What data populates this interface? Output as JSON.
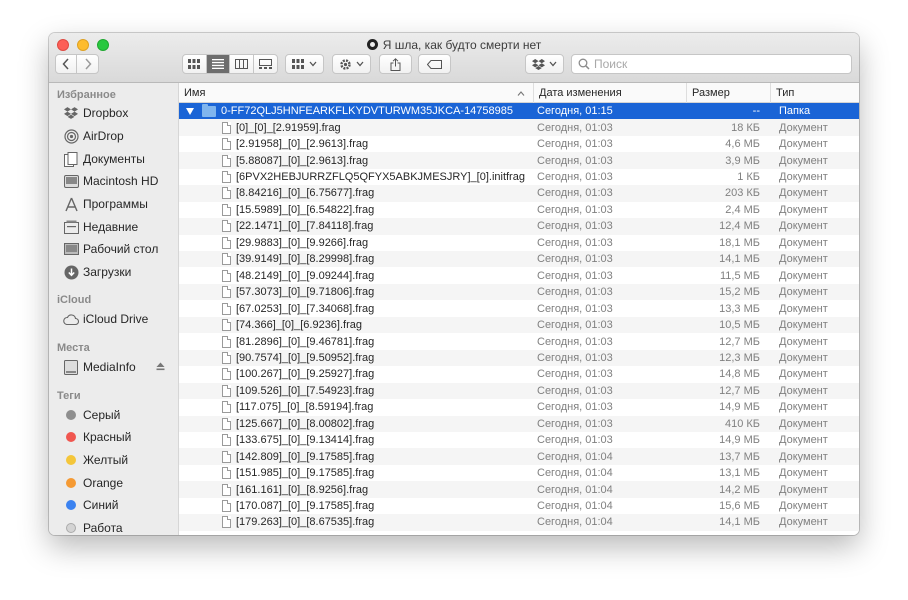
{
  "window": {
    "title": "Я шла, как будто смерти нет"
  },
  "toolbar": {
    "search_placeholder": "Поиск"
  },
  "colors": {
    "accent": "#1a64d6",
    "tag_gray": "#8e8e8e",
    "tag_red": "#f0564f",
    "tag_yellow": "#f4c63a",
    "tag_orange": "#f59a33",
    "tag_blue": "#3b82f0",
    "tag_work": "#d4d4d4"
  },
  "sidebar": {
    "favorites_label": "Избранное",
    "icloud_label": "iCloud",
    "places_label": "Места",
    "tags_label": "Теги",
    "favorites": [
      {
        "label": "Dropbox",
        "icon": "dropbox-icon"
      },
      {
        "label": "AirDrop",
        "icon": "airdrop-icon"
      },
      {
        "label": "Документы",
        "icon": "documents-icon"
      },
      {
        "label": "Macintosh HD",
        "icon": "harddrive-icon"
      },
      {
        "label": "Программы",
        "icon": "applications-icon"
      },
      {
        "label": "Недавние",
        "icon": "recents-icon"
      },
      {
        "label": "Рабочий стол",
        "icon": "desktop-icon"
      },
      {
        "label": "Загрузки",
        "icon": "downloads-icon"
      }
    ],
    "icloud": [
      {
        "label": "iCloud Drive",
        "icon": "cloud-icon"
      }
    ],
    "places": [
      {
        "label": "MediaInfo",
        "icon": "disk-icon"
      }
    ],
    "tags": [
      {
        "label": "Серый"
      },
      {
        "label": "Красный"
      },
      {
        "label": "Желтый"
      },
      {
        "label": "Orange"
      },
      {
        "label": "Синий"
      },
      {
        "label": "Работа"
      }
    ]
  },
  "columns": {
    "name": "Имя",
    "date": "Дата изменения",
    "size": "Размер",
    "kind": "Тип"
  },
  "folder": {
    "name": "0-FF72QLJ5HNFEARKFLKYDVTURWM35JKCA-14758985",
    "date": "Сегодня, 01:15",
    "size": "--",
    "kind": "Папка"
  },
  "files": [
    {
      "name": "[0]_[0]_[2.91959].frag",
      "date": "Сегодня, 01:03",
      "size": "18 КБ",
      "kind": "Документ"
    },
    {
      "name": "[2.91958]_[0]_[2.9613].frag",
      "date": "Сегодня, 01:03",
      "size": "4,6 МБ",
      "kind": "Документ"
    },
    {
      "name": "[5.88087]_[0]_[2.9613].frag",
      "date": "Сегодня, 01:03",
      "size": "3,9 МБ",
      "kind": "Документ"
    },
    {
      "name": "[6PVX2HEBJURRZFLQ5QFYX5ABKJMESJRY]_[0].initfrag",
      "date": "Сегодня, 01:03",
      "size": "1 КБ",
      "kind": "Документ"
    },
    {
      "name": "[8.84216]_[0]_[6.75677].frag",
      "date": "Сегодня, 01:03",
      "size": "203 КБ",
      "kind": "Документ"
    },
    {
      "name": "[15.5989]_[0]_[6.54822].frag",
      "date": "Сегодня, 01:03",
      "size": "2,4 МБ",
      "kind": "Документ"
    },
    {
      "name": "[22.1471]_[0]_[7.84118].frag",
      "date": "Сегодня, 01:03",
      "size": "12,4 МБ",
      "kind": "Документ"
    },
    {
      "name": "[29.9883]_[0]_[9.9266].frag",
      "date": "Сегодня, 01:03",
      "size": "18,1 МБ",
      "kind": "Документ"
    },
    {
      "name": "[39.9149]_[0]_[8.29998].frag",
      "date": "Сегодня, 01:03",
      "size": "14,1 МБ",
      "kind": "Документ"
    },
    {
      "name": "[48.2149]_[0]_[9.09244].frag",
      "date": "Сегодня, 01:03",
      "size": "11,5 МБ",
      "kind": "Документ"
    },
    {
      "name": "[57.3073]_[0]_[9.71806].frag",
      "date": "Сегодня, 01:03",
      "size": "15,2 МБ",
      "kind": "Документ"
    },
    {
      "name": "[67.0253]_[0]_[7.34068].frag",
      "date": "Сегодня, 01:03",
      "size": "13,3 МБ",
      "kind": "Документ"
    },
    {
      "name": "[74.366]_[0]_[6.9236].frag",
      "date": "Сегодня, 01:03",
      "size": "10,5 МБ",
      "kind": "Документ"
    },
    {
      "name": "[81.2896]_[0]_[9.46781].frag",
      "date": "Сегодня, 01:03",
      "size": "12,7 МБ",
      "kind": "Документ"
    },
    {
      "name": "[90.7574]_[0]_[9.50952].frag",
      "date": "Сегодня, 01:03",
      "size": "12,3 МБ",
      "kind": "Документ"
    },
    {
      "name": "[100.267]_[0]_[9.25927].frag",
      "date": "Сегодня, 01:03",
      "size": "14,8 МБ",
      "kind": "Документ"
    },
    {
      "name": "[109.526]_[0]_[7.54923].frag",
      "date": "Сегодня, 01:03",
      "size": "12,7 МБ",
      "kind": "Документ"
    },
    {
      "name": "[117.075]_[0]_[8.59194].frag",
      "date": "Сегодня, 01:03",
      "size": "14,9 МБ",
      "kind": "Документ"
    },
    {
      "name": "[125.667]_[0]_[8.00802].frag",
      "date": "Сегодня, 01:03",
      "size": "410 КБ",
      "kind": "Документ"
    },
    {
      "name": "[133.675]_[0]_[9.13414].frag",
      "date": "Сегодня, 01:03",
      "size": "14,9 МБ",
      "kind": "Документ"
    },
    {
      "name": "[142.809]_[0]_[9.17585].frag",
      "date": "Сегодня, 01:04",
      "size": "13,7 МБ",
      "kind": "Документ"
    },
    {
      "name": "[151.985]_[0]_[9.17585].frag",
      "date": "Сегодня, 01:04",
      "size": "13,1 МБ",
      "kind": "Документ"
    },
    {
      "name": "[161.161]_[0]_[8.9256].frag",
      "date": "Сегодня, 01:04",
      "size": "14,2 МБ",
      "kind": "Документ"
    },
    {
      "name": "[170.087]_[0]_[9.17585].frag",
      "date": "Сегодня, 01:04",
      "size": "15,6 МБ",
      "kind": "Документ"
    },
    {
      "name": "[179.263]_[0]_[8.67535].frag",
      "date": "Сегодня, 01:04",
      "size": "14,1 МБ",
      "kind": "Документ"
    }
  ]
}
